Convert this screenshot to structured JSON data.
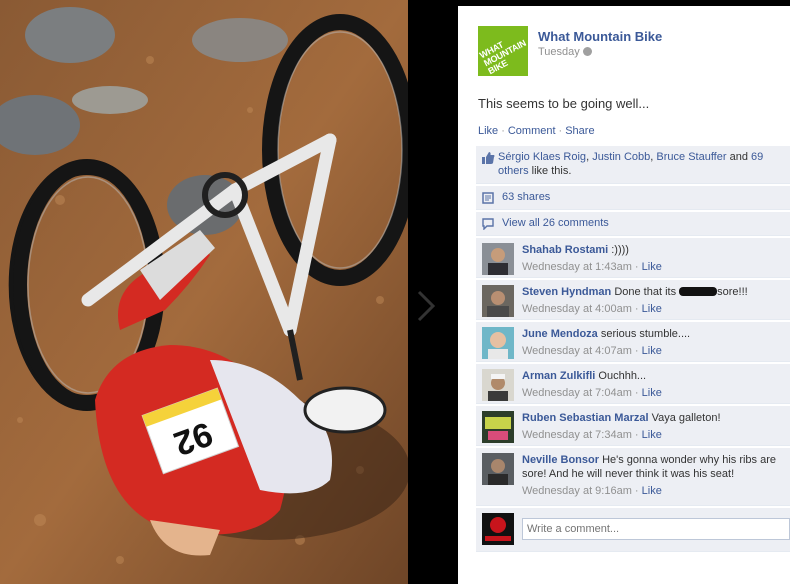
{
  "post": {
    "page_name": "What Mountain Bike",
    "time": "Tuesday",
    "logo_text": [
      "WHAT",
      "MOUNTAIN",
      "BIKE"
    ],
    "text": "This seems to be going well...",
    "actions": [
      "Like",
      "Comment",
      "Share"
    ]
  },
  "likes": {
    "names": [
      "Sérgio Klaes Roig",
      "Justin Cobb",
      "Bruce Stauffer"
    ],
    "and": "and",
    "others_link": "69 others",
    "suffix": "like this."
  },
  "shares": {
    "label": "63 shares"
  },
  "view_all": {
    "label": "View all 26 comments"
  },
  "comments": [
    {
      "name": "Shahab Rostami",
      "text": ":))))",
      "time": "Wednesday at 1:43am",
      "like": "Like"
    },
    {
      "name": "Steven Hyndman",
      "text_before": "Done that its",
      "text_after": "sore!!!",
      "time": "Wednesday at 4:00am",
      "like": "Like"
    },
    {
      "name": "June Mendoza",
      "text": "serious stumble....",
      "time": "Wednesday at 4:07am",
      "like": "Like"
    },
    {
      "name": "Arman Zulkifli",
      "text": "Ouchhh...",
      "time": "Wednesday at 7:04am",
      "like": "Like"
    },
    {
      "name": "Ruben Sebastian Marzal",
      "text": "Vaya galleton!",
      "time": "Wednesday at 7:34am",
      "like": "Like"
    },
    {
      "name": "Neville Bonsor",
      "text": "He's gonna wonder why his ribs are sore! And he will never think it was his seat!",
      "time": "Wednesday at 9:16am",
      "like": "Like"
    }
  ],
  "write_comment": {
    "placeholder": "Write a comment..."
  },
  "photo": {
    "bib_number": "92"
  },
  "colors": {
    "link": "#3b5998",
    "ufi_bg": "#edeff4",
    "logo_green": "#7dbb1d"
  }
}
